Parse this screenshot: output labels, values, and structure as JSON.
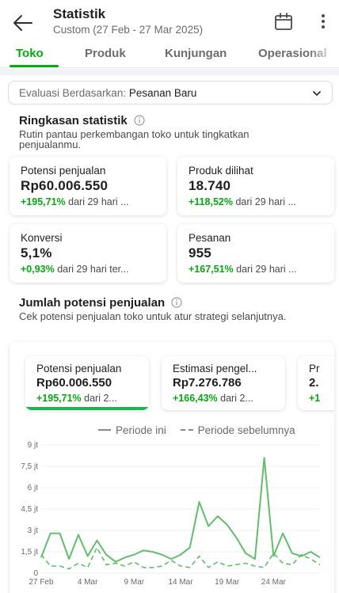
{
  "header": {
    "title": "Statistik",
    "subtitle": "Custom (27 Feb - 27 Mar 2025)"
  },
  "tabs": [
    {
      "label": "Toko",
      "active": true
    },
    {
      "label": "Produk",
      "active": false
    },
    {
      "label": "Kunjungan",
      "active": false
    },
    {
      "label": "Operasional",
      "active": false
    }
  ],
  "evaluation": {
    "prefix": "Evaluasi Berdasarkan: ",
    "value": "Pesanan Baru"
  },
  "summary": {
    "title": "Ringkasan statistik",
    "description": "Rutin pantau perkembangan toko untuk tingkatkan penjualanmu.",
    "cards": [
      {
        "label": "Potensi penjualan",
        "value": "Rp60.006.550",
        "change": "+195,71%",
        "compare": " dari 29 hari ..."
      },
      {
        "label": "Produk dilihat",
        "value": "18.740",
        "change": "+118,52%",
        "compare": " dari 29 hari ..."
      },
      {
        "label": "Konversi",
        "value": "5,1%",
        "change": "+0,93%",
        "compare": " dari 29 hari ter..."
      },
      {
        "label": "Pesanan",
        "value": "955",
        "change": "+167,51%",
        "compare": " dari 29 hari ..."
      }
    ]
  },
  "sales": {
    "title": "Jumlah potensi penjualan",
    "description": "Cek potensi penjualan toko untuk atur strategi selanjutnya.",
    "metric_cards": [
      {
        "label": "Potensi penjualan",
        "value": "Rp60.006.550",
        "change": "+195,71%",
        "compare": " dari 2...",
        "selected": true
      },
      {
        "label": "Estimasi pengel...",
        "value": "Rp7.276.786",
        "change": "+166,43%",
        "compare": " dari 2...",
        "selected": false
      },
      {
        "label": "Pr",
        "value": "2.",
        "change": "+1",
        "compare": "",
        "selected": false
      }
    ],
    "legend": {
      "current": "Periode ini",
      "previous": "Periode sebelumnya"
    }
  },
  "colors": {
    "accent": "#03ac0e",
    "line": "#5fbf6a"
  },
  "icons": [
    "arrow-left-icon",
    "calendar-icon",
    "more-vertical-icon",
    "chevron-down-icon",
    "info-icon"
  ],
  "chart_data": {
    "type": "line",
    "title": "",
    "xlabel": "",
    "ylabel": "",
    "ylim": [
      0,
      9000000
    ],
    "yticks": [
      0,
      1500000,
      3000000,
      4500000,
      6000000,
      7500000,
      9000000
    ],
    "ytick_labels": [
      "0",
      "1,5 jt",
      "3 jt",
      "4,5 jt",
      "6 jt",
      "7,5 jt",
      "9 jt"
    ],
    "xtick_labels": [
      "27 Feb",
      "4 Mar",
      "9 Mar",
      "14 Mar",
      "19 Mar",
      "24 Mar"
    ],
    "x": [
      "27 Feb",
      "28 Feb",
      "1 Mar",
      "2 Mar",
      "3 Mar",
      "4 Mar",
      "5 Mar",
      "6 Mar",
      "7 Mar",
      "8 Mar",
      "9 Mar",
      "10 Mar",
      "11 Mar",
      "12 Mar",
      "13 Mar",
      "14 Mar",
      "15 Mar",
      "16 Mar",
      "17 Mar",
      "18 Mar",
      "19 Mar",
      "20 Mar",
      "21 Mar",
      "22 Mar",
      "23 Mar",
      "24 Mar",
      "25 Mar",
      "26 Mar",
      "27 Mar"
    ],
    "series": [
      {
        "name": "Periode ini",
        "style": "solid",
        "values": [
          1100000,
          2800000,
          2800000,
          1000000,
          2700000,
          1200000,
          2300000,
          1300000,
          800000,
          1100000,
          1300000,
          1600000,
          1500000,
          1300000,
          1000000,
          1300000,
          1800000,
          5000000,
          3300000,
          4000000,
          3400000,
          2500000,
          1400000,
          1000000,
          8100000,
          1200000,
          2800000,
          1400000,
          1200000,
          1500000,
          1100000
        ]
      },
      {
        "name": "Periode sebelumnya",
        "style": "dashed",
        "values": [
          1300000,
          500000,
          500000,
          300000,
          700000,
          400000,
          1800000,
          600000,
          700000,
          500000,
          800000,
          400000,
          400000,
          500000,
          900000,
          500000,
          400000,
          1200000,
          400000,
          800000,
          500000,
          600000,
          700000,
          500000,
          400000,
          1400000,
          700000,
          600000,
          1300000,
          1000000,
          600000
        ]
      }
    ]
  }
}
